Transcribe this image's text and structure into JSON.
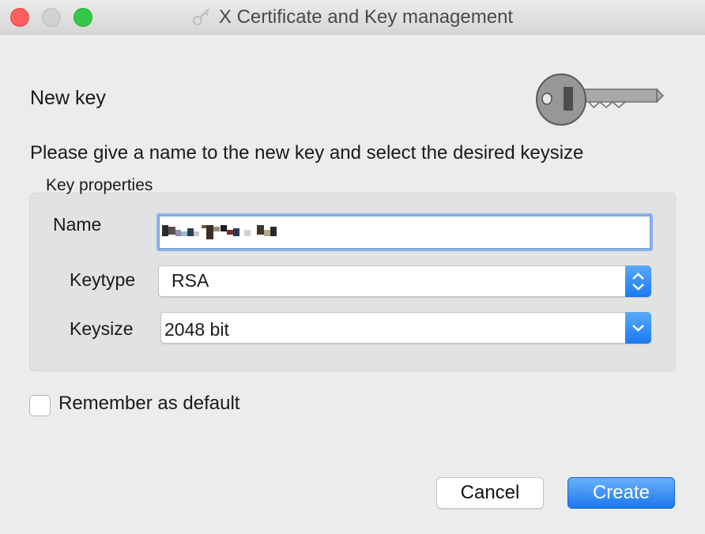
{
  "window": {
    "title": "X Certificate and Key management",
    "app_icon": "key-app-icon"
  },
  "dialog": {
    "heading": "New key",
    "instruction": "Please give a name to the new key and select the desired keysize",
    "key_image": "key-illustration",
    "group_title": "Key properties"
  },
  "fields": {
    "name_label": "Name",
    "name_value": "",
    "keytype_label": "Keytype",
    "keytype_value": "RSA",
    "keysize_label": "Keysize",
    "keysize_value": "2048 bit"
  },
  "options": {
    "remember_label": "Remember as default",
    "remember_checked": false
  },
  "buttons": {
    "cancel": "Cancel",
    "create": "Create"
  },
  "colors": {
    "accent": "#1b78ef",
    "close": "#fc615d",
    "maximize": "#34c84a"
  }
}
